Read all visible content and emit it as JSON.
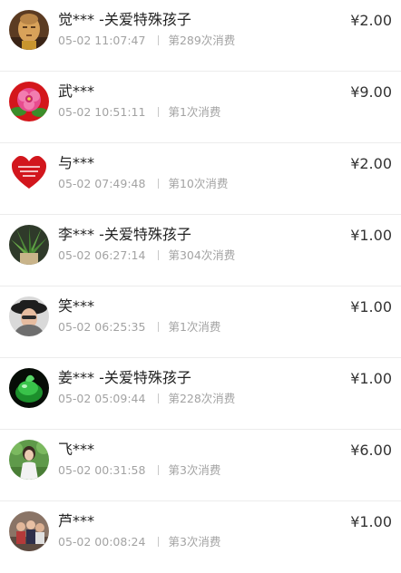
{
  "donations": [
    {
      "name": "觉*** -关爱特殊孩子",
      "time": "05-02 11:07:47",
      "count": "第289次消费",
      "amount": "¥2.00",
      "avatar": "buddha-statue"
    },
    {
      "name": "武***",
      "time": "05-02 10:51:11",
      "count": "第1次消费",
      "amount": "¥9.00",
      "avatar": "peony-flower"
    },
    {
      "name": "与***",
      "time": "05-02 07:49:48",
      "count": "第10次消费",
      "amount": "¥2.00",
      "avatar": "red-heart"
    },
    {
      "name": "李*** -关爱特殊孩子",
      "time": "05-02 06:27:14",
      "count": "第304次消费",
      "amount": "¥1.00",
      "avatar": "potted-plant"
    },
    {
      "name": "笑***",
      "time": "05-02 06:25:35",
      "count": "第1次消费",
      "amount": "¥1.00",
      "avatar": "woman-hat"
    },
    {
      "name": "姜*** -关爱特殊孩子",
      "time": "05-02 05:09:44",
      "count": "第228次消费",
      "amount": "¥1.00",
      "avatar": "green-jade"
    },
    {
      "name": "飞***",
      "time": "05-02 00:31:58",
      "count": "第3次消费",
      "amount": "¥6.00",
      "avatar": "woman-outdoor"
    },
    {
      "name": "芦***",
      "time": "05-02 00:08:24",
      "count": "第3次消费",
      "amount": "¥1.00",
      "avatar": "group-photo"
    }
  ]
}
